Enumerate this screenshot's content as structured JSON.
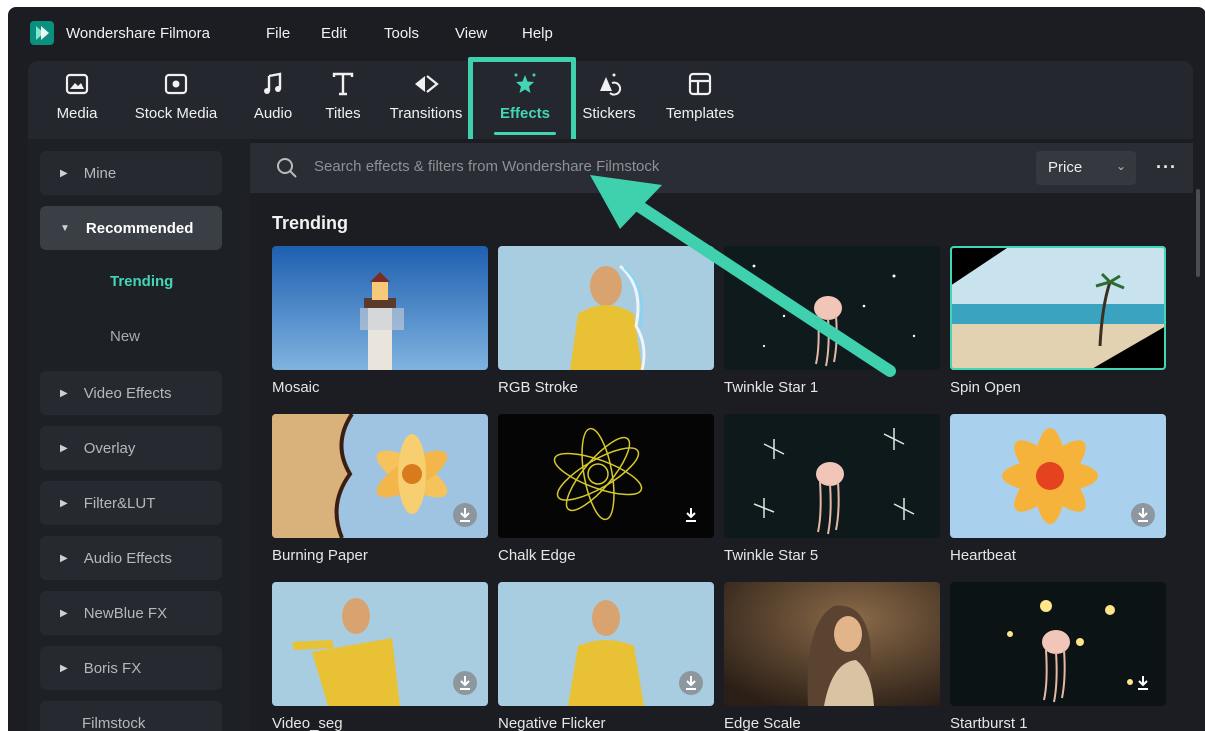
{
  "app": {
    "name": "Wondershare Filmora",
    "logo_icon": "filmora-logo-icon"
  },
  "menu": [
    "File",
    "Edit",
    "Tools",
    "View",
    "Help"
  ],
  "toolbar": {
    "tabs": [
      {
        "label": "Media",
        "icon": "media-icon"
      },
      {
        "label": "Stock Media",
        "icon": "stock-media-icon"
      },
      {
        "label": "Audio",
        "icon": "music-note-icon"
      },
      {
        "label": "Titles",
        "icon": "title-text-icon"
      },
      {
        "label": "Transitions",
        "icon": "transitions-icon"
      },
      {
        "label": "Effects",
        "icon": "effects-star-icon",
        "active": true
      },
      {
        "label": "Stickers",
        "icon": "stickers-icon"
      },
      {
        "label": "Templates",
        "icon": "templates-icon"
      }
    ]
  },
  "sidebar": {
    "items": [
      {
        "label": "Mine",
        "state": "collapsed"
      },
      {
        "label": "Recommended",
        "state": "expanded"
      },
      {
        "label": "Trending",
        "type": "sub",
        "selected": true
      },
      {
        "label": "New",
        "type": "sub"
      },
      {
        "label": "Video Effects",
        "state": "collapsed"
      },
      {
        "label": "Overlay",
        "state": "collapsed"
      },
      {
        "label": "Filter&LUT",
        "state": "collapsed"
      },
      {
        "label": "Audio Effects",
        "state": "collapsed"
      },
      {
        "label": "NewBlue FX",
        "state": "collapsed"
      },
      {
        "label": "Boris FX",
        "state": "collapsed"
      },
      {
        "label": "Filmstock",
        "type": "plain"
      }
    ]
  },
  "search": {
    "placeholder": "Search effects & filters from Wondershare Filmstock"
  },
  "sort": {
    "selected": "Price"
  },
  "section": {
    "title": "Trending"
  },
  "effects": [
    {
      "label": "Mosaic",
      "download": false
    },
    {
      "label": "RGB Stroke",
      "download": false
    },
    {
      "label": "Twinkle Star 1",
      "download": false
    },
    {
      "label": "Spin Open",
      "download": false,
      "selected": true
    },
    {
      "label": "Burning Paper",
      "download": true
    },
    {
      "label": "Chalk Edge",
      "download": true
    },
    {
      "label": "Twinkle Star 5",
      "download": false
    },
    {
      "label": "Heartbeat",
      "download": true
    },
    {
      "label": "Video_seg",
      "download": true
    },
    {
      "label": "Negative Flicker",
      "download": true
    },
    {
      "label": "Edge Scale",
      "download": false
    },
    {
      "label": "Startburst 1",
      "download": true
    }
  ],
  "colors": {
    "accent": "#43d6b5",
    "background": "#1b1d22",
    "panel": "#24272d"
  }
}
